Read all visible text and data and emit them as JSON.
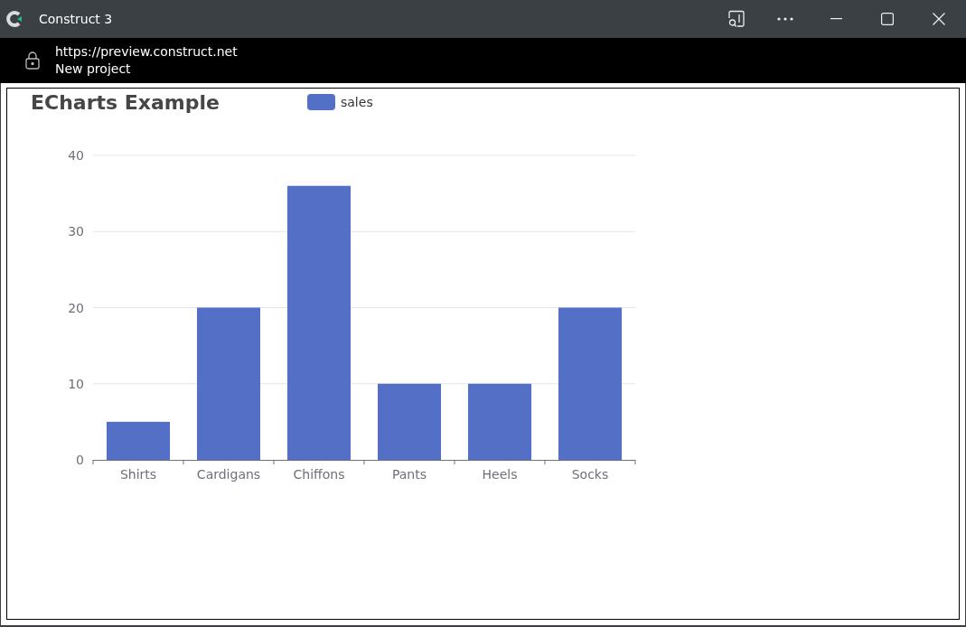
{
  "window": {
    "title": "Construct 3"
  },
  "address_bar": {
    "url": "https://preview.construct.net",
    "page_title": "New project"
  },
  "chart": {
    "title": "ECharts Example",
    "chart_data": {
      "type": "bar",
      "categories": [
        "Shirts",
        "Cardigans",
        "Chiffons",
        "Pants",
        "Heels",
        "Socks"
      ],
      "series": [
        {
          "name": "sales",
          "color": "#5470c6",
          "values": [
            5,
            20,
            36,
            10,
            10,
            20
          ]
        }
      ],
      "ylim": [
        0,
        40
      ],
      "yticks": [
        0,
        10,
        20,
        30,
        40
      ],
      "grid": true
    }
  }
}
